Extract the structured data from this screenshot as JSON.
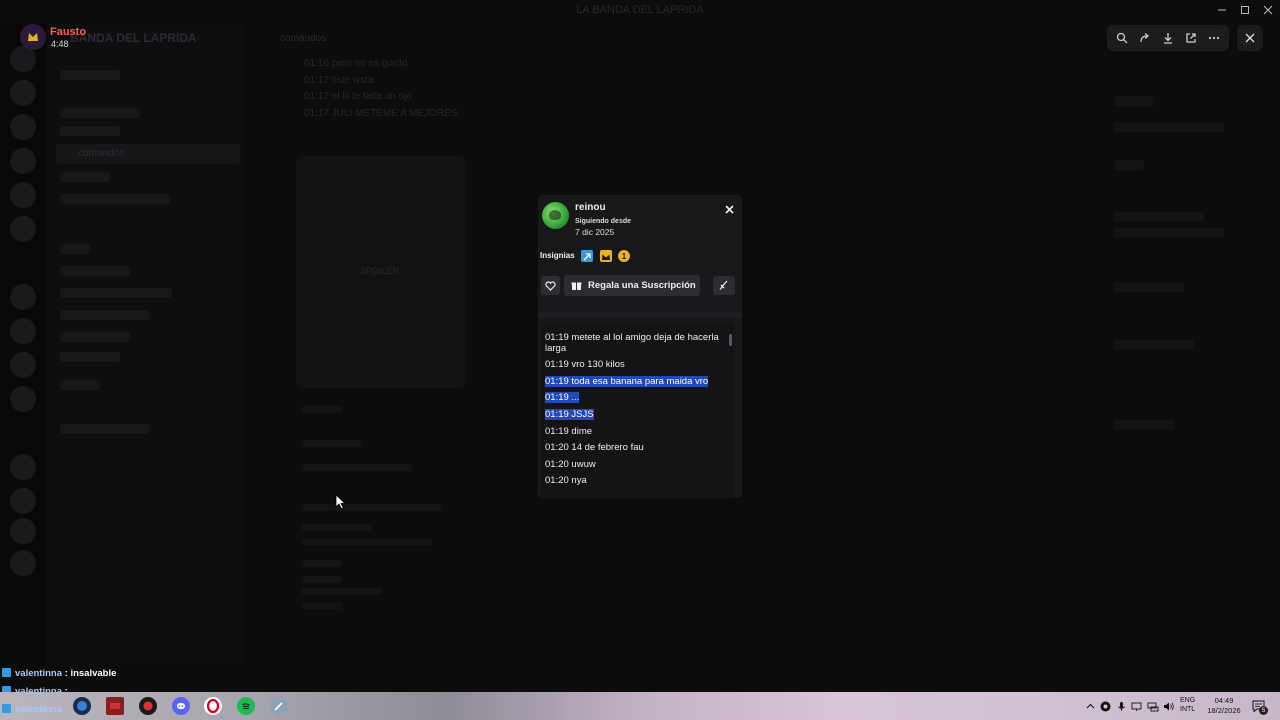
{
  "window": {
    "title": "LA BANDA DEL LAPRIDA"
  },
  "server": {
    "name": "BANDA DEL LAPRIDA",
    "channel": "comandos"
  },
  "background_chat": {
    "lines": [
      "01:16 pero no es gordo",
      "01:17 tiste wsta",
      "01:17 el lil te falta un ojo",
      "01:17 JULI METEME A MEJORES"
    ],
    "spoiler": "SPOILER"
  },
  "notification": {
    "name": "Fausto",
    "time": "4:48"
  },
  "profile_popup": {
    "username": "reinou",
    "follow_label": "Siguiendo desde",
    "follow_date": "7 dic 2025",
    "badges_label": "Insignias",
    "badge_count": "1",
    "gift_button": "Regala una Suscripción",
    "messages": [
      {
        "time": "01:19",
        "text": "metete al lol amigo deja de hacerla larga",
        "highlighted": false
      },
      {
        "time": "01:19",
        "text": "vro 130 kilos",
        "highlighted": false
      },
      {
        "time": "01:19",
        "text": "toda esa banana para maida vro",
        "highlighted": true
      },
      {
        "time": "01:19",
        "text": "...",
        "highlighted": true
      },
      {
        "time": "01:19",
        "text": "JSJS",
        "highlighted": true
      },
      {
        "time": "01:19",
        "text": "dime",
        "highlighted": false
      },
      {
        "time": "01:20",
        "text": "14 de febrero fau",
        "highlighted": false
      },
      {
        "time": "01:20",
        "text": "uwuw",
        "highlighted": false
      },
      {
        "time": "01:20",
        "text": "nya",
        "highlighted": false
      }
    ]
  },
  "overlay_chat": [
    {
      "user": "valentinna",
      "text": ": insalvable"
    },
    {
      "user": "valentinna",
      "text": ":"
    },
    {
      "user": "valentinna",
      "text": ""
    }
  ],
  "tray": {
    "lang_1": "ENG",
    "lang_2": "INTL",
    "time": "04:49",
    "date": "18/2/2026",
    "notif_count": "5"
  },
  "colors": {
    "highlight": "#2348b8",
    "popup_bg": "#18181b",
    "notification_name": "#ff5a5a"
  }
}
